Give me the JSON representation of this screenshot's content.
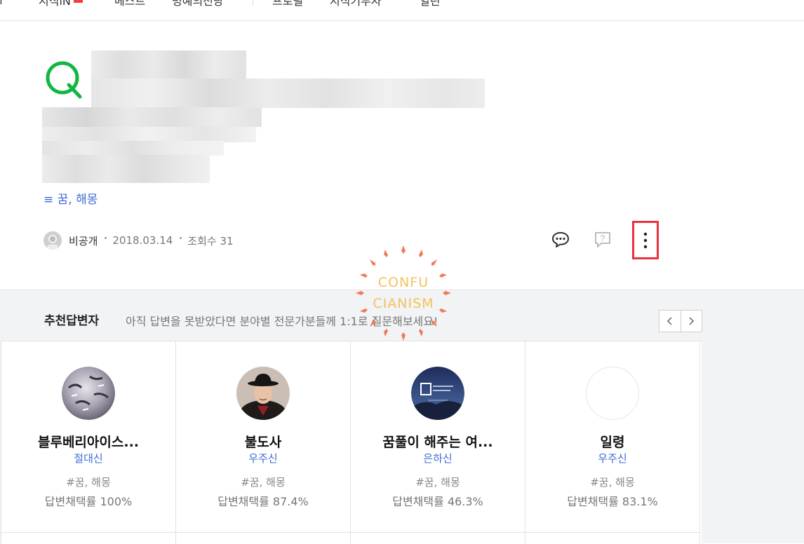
{
  "nav": {
    "item_1": "ㅜ",
    "item_2": "지식iN",
    "item_3": "베스트",
    "item_4": "명예의전당",
    "item_5": "프로필",
    "item_6": "지식기부자",
    "item_7": "열린"
  },
  "question": {
    "mark": "Q",
    "tags": "≡ 꿈, 해몽",
    "author": "비공개",
    "date": "2018.03.14",
    "views": "조회수 31"
  },
  "actions": {
    "comment_icon": "speech-bubble-icon",
    "question_icon": "question-bubble-icon",
    "more_icon": "vertical-ellipsis-icon"
  },
  "recommend": {
    "title": "추천답변자",
    "description": "아직 답변을 못받았다면 분야별 전문가분들께 1:1로 질문해보세요!",
    "prev_icon": "chevron-left-icon",
    "next_icon": "chevron-right-icon",
    "experts": [
      {
        "name": "블루베리아이스...",
        "rank": "절대신",
        "tags": "#꿈, 해몽",
        "rate": "답변채택률 100%"
      },
      {
        "name": "불도사",
        "rank": "우주신",
        "tags": "#꿈, 해몽",
        "rate": "답변채택률 87.4%"
      },
      {
        "name": "꿈풀이 해주는 여...",
        "rank": "은하신",
        "tags": "#꿈, 해몽",
        "rate": "답변채택률 46.3%"
      },
      {
        "name": "일령",
        "rank": "우주신",
        "tags": "#꿈, 해몽",
        "rate": "답변채택률 83.1%"
      }
    ]
  },
  "watermark": {
    "line1": "CONFU",
    "line2": "CIANISM"
  },
  "colors": {
    "q_green": "#12b642",
    "link_blue": "#3f6bd3",
    "highlight_red": "#e8323c",
    "section_bg": "#f2f3f5"
  }
}
